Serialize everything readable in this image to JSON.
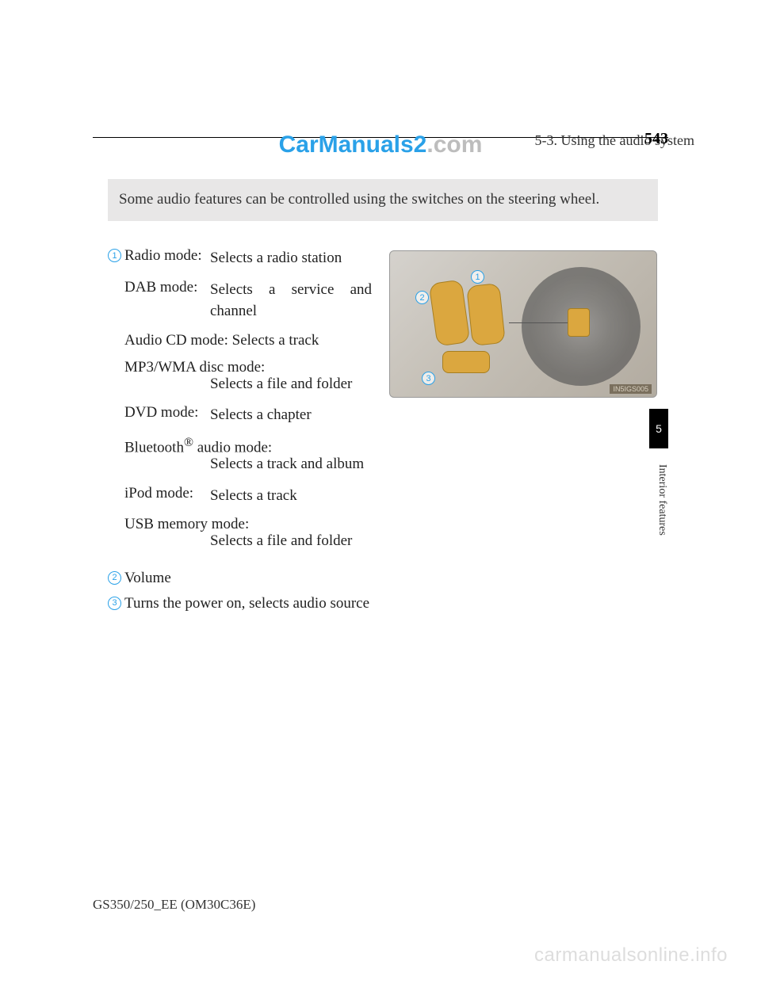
{
  "header": {
    "section": "5-3. Using the audio system",
    "page_number": "543"
  },
  "watermark": {
    "top_part1": "CarManuals2",
    "top_part2": ".com",
    "bottom": "carmanualsonline.info"
  },
  "intro": "Some audio features can be controlled using the switches on the steering wheel.",
  "items": [
    {
      "num": "1",
      "modes": [
        {
          "label": "Radio mode:",
          "desc": "Selects a radio station"
        },
        {
          "label": "DAB mode:",
          "desc": "Selects a service and channel"
        },
        {
          "label": "Audio CD mode: ",
          "desc": "Selects a track",
          "inline": true
        },
        {
          "label": "MP3/WMA disc mode:",
          "desc": "Selects a file and folder",
          "wrap": true
        },
        {
          "label": "DVD mode:",
          "desc": "Selects a chapter"
        },
        {
          "label_html": true,
          "label": "Bluetooth",
          "sup": "®",
          "label2": " audio mode:",
          "desc": "Selects a track and album",
          "wrap": true
        },
        {
          "label": "iPod mode: ",
          "desc": "Selects a track"
        },
        {
          "label": "USB memory mode:",
          "desc": "Selects a file and folder",
          "wrap": true
        }
      ]
    },
    {
      "num": "2",
      "text": "Volume"
    },
    {
      "num": "3",
      "text": "Turns the power on, selects audio source"
    }
  ],
  "figure": {
    "code": "IN5IGS005",
    "numbers": [
      "1",
      "2",
      "3"
    ]
  },
  "side": {
    "chapter": "5",
    "label": "Interior features"
  },
  "footer": "GS350/250_EE (OM30C36E)"
}
